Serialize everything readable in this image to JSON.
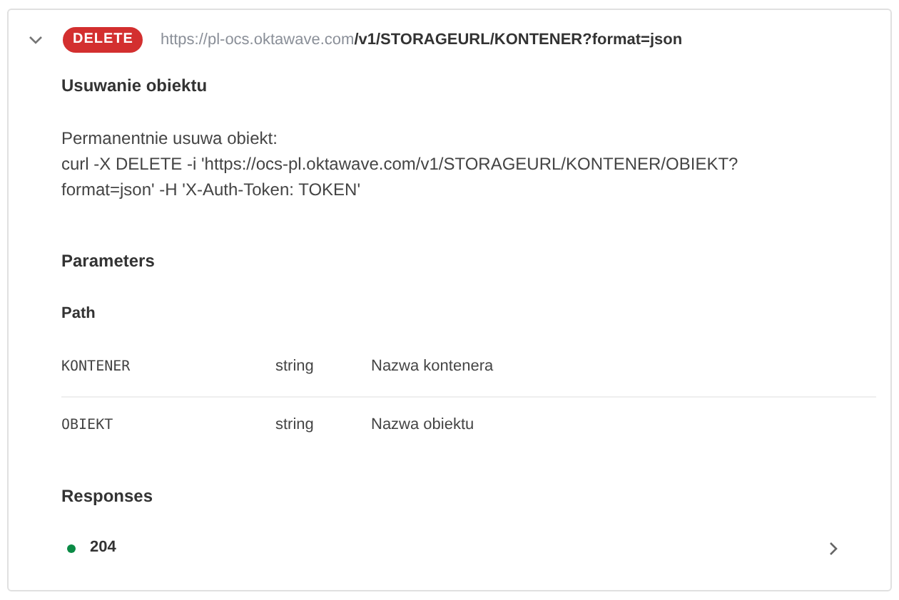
{
  "operation": {
    "expanded": true,
    "method": "DELETE",
    "url_base": "https://pl-ocs.oktawave.com",
    "url_path": "/v1/STORAGEURL/KONTENER?format=json",
    "summary": "Usuwanie obiektu",
    "description": [
      "Permanentnie usuwa obiekt:",
      "curl -X DELETE -i 'https://ocs-pl.oktawave.com/v1/STORAGEURL/KONTENER/OBIEKT?format=json' -H 'X-Auth-Token: TOKEN'"
    ]
  },
  "parameters": {
    "title": "Parameters",
    "group": "Path",
    "rows": [
      {
        "name": "KONTENER",
        "type": "string",
        "description": "Nazwa kontenera"
      },
      {
        "name": "OBIEKT",
        "type": "string",
        "description": "Nazwa obiektu"
      }
    ]
  },
  "responses": {
    "title": "Responses",
    "items": [
      {
        "code": "204",
        "color": "#0a8a45"
      }
    ]
  }
}
